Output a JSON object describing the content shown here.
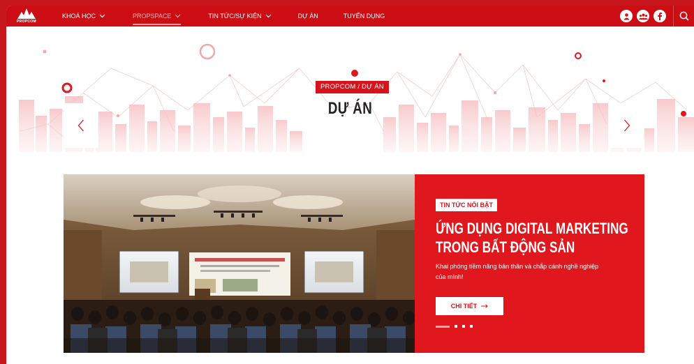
{
  "brand": {
    "name": "PROPCOM",
    "color": "#cc0e14"
  },
  "nav": {
    "items": [
      {
        "label": "KHOÁ HỌC",
        "has_dropdown": true,
        "active": false
      },
      {
        "label": "PROPSPACE",
        "has_dropdown": true,
        "active": true
      },
      {
        "label": "TIN TỨC/SỰ KIỆN",
        "has_dropdown": true,
        "active": false
      },
      {
        "label": "DỰ ÁN",
        "has_dropdown": false,
        "active": false
      },
      {
        "label": "TUYỂN DỤNG",
        "has_dropdown": false,
        "active": false
      }
    ],
    "social_icons": [
      "user-icon",
      "group-icon",
      "facebook-icon"
    ],
    "search_icon": "search-icon"
  },
  "hero": {
    "breadcrumb": "PROPCOM / DỰ ÁN",
    "title": "DỰ ÁN"
  },
  "featured": {
    "badge": "TIN TỨC NỔI BẬT",
    "title_line1": "ỨNG DỤNG DIGITAL MARKETING",
    "title_line2": "TRONG BẤT ĐỘNG SẢN",
    "description": "Khai phóng tiềm năng bản thân và chắp cánh nghề nghiệp của mình!",
    "cta_label": "CHI TIẾT",
    "slide_count": 4,
    "active_slide": 1
  }
}
